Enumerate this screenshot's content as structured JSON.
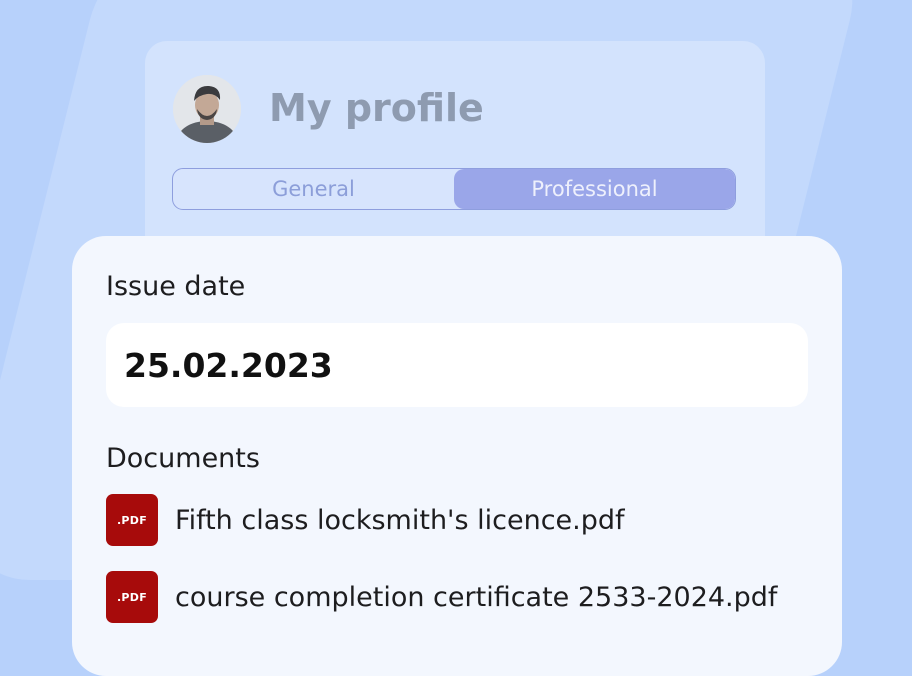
{
  "header": {
    "title": "My profile",
    "avatar_icon": "user-avatar-photo"
  },
  "tabs": [
    {
      "label": "General",
      "active": false
    },
    {
      "label": "Professional",
      "active": true
    }
  ],
  "issue_date": {
    "label": "Issue date",
    "value": "25.02.2023"
  },
  "documents": {
    "label": "Documents",
    "items": [
      {
        "icon_text": ".PDF",
        "name": "Fifth class locksmith's licence.pdf"
      },
      {
        "icon_text": ".PDF",
        "name": "course completion certificate 2533-2024.pdf"
      }
    ]
  },
  "colors": {
    "background": "#b7d1fb",
    "pdf_icon": "#a70b0b",
    "active_tab": "#9aa6e9"
  }
}
